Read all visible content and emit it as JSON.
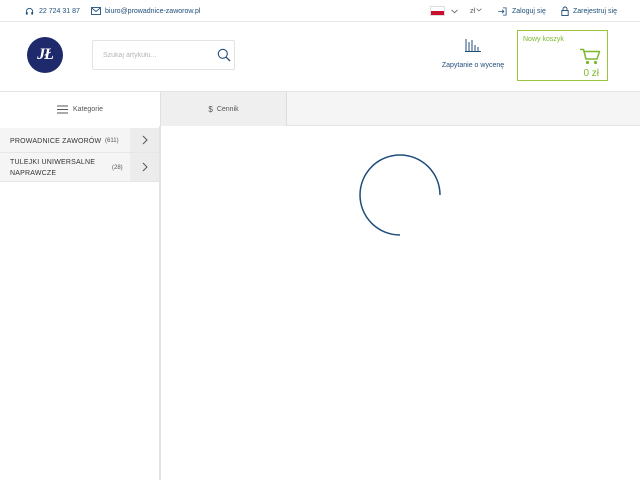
{
  "topbar": {
    "phone": "22 724 31 87",
    "email": "biuro@prowadnice-zaworow.pl",
    "language_flag": "poland-flag-icon",
    "currency": "zł",
    "login": "Zaloguj się",
    "register": "Zarejestruj się"
  },
  "header": {
    "logo_text": "JŁ",
    "search_placeholder": "Szukaj artykułu...",
    "quote_label": "Zapytanie o wycenę",
    "cart_title": "Nowy koszyk",
    "cart_total": "0 zł"
  },
  "nav": {
    "categories": "Kategorie",
    "pricelist": "Cennik",
    "pricelist_icon": "$"
  },
  "categories": [
    {
      "name": "PROWADNICE ZAWORÓW",
      "count": "(611)"
    },
    {
      "name": "TULEJKI UNIWERSALNE NAPRAWCZE",
      "count": "(28)"
    }
  ],
  "colors": {
    "primary": "#1f4e79",
    "accent_green": "#7cb82f",
    "cart_border": "#9bc53d",
    "logo_bg": "#1e2a6b",
    "spinner": "#1f4e79"
  }
}
